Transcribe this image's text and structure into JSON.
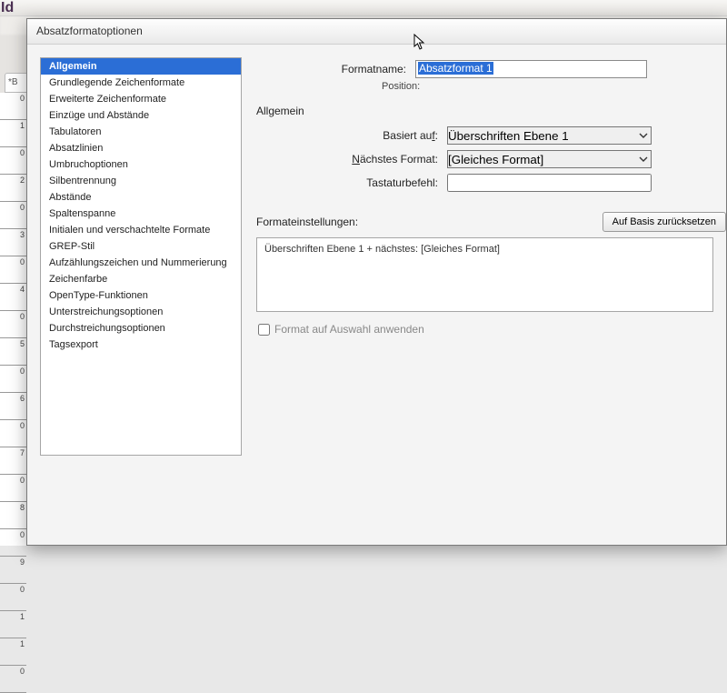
{
  "bg": {
    "logo": "Id",
    "tab": "*B",
    "ruler_ticks": [
      "0",
      "1",
      "0",
      "2",
      "0",
      "3",
      "0",
      "4",
      "0",
      "5",
      "0",
      "6",
      "0",
      "7",
      "0",
      "8",
      "0",
      "9",
      "0",
      "1",
      "1",
      "0"
    ]
  },
  "dialog": {
    "title": "Absatzformatoptionen"
  },
  "sidebar": {
    "items": [
      "Allgemein",
      "Grundlegende Zeichenformate",
      "Erweiterte Zeichenformate",
      "Einzüge und Abstände",
      "Tabulatoren",
      "Absatzlinien",
      "Umbruchoptionen",
      "Silbentrennung",
      "Abstände",
      "Spaltenspanne",
      "Initialen und verschachtelte Formate",
      "GREP-Stil",
      "Aufzählungszeichen und Nummerierung",
      "Zeichenfarbe",
      "OpenType-Funktionen",
      "Unterstreichungsoptionen",
      "Durchstreichungsoptionen",
      "Tagsexport"
    ],
    "selected_index": 0
  },
  "form": {
    "formatname_label": "Formatname:",
    "formatname_value": "Absatzformat 1",
    "position_label": "Position:",
    "section_heading": "Allgemein",
    "basiert_label_pre": "Basiert au",
    "basiert_label_u": "f",
    "basiert_label_post": ":",
    "basiert_value": "Überschriften Ebene 1",
    "naechstes_label_u": "N",
    "naechstes_label_rest": "ächstes Format:",
    "naechstes_value": "[Gleiches Format]",
    "tastatur_label": "Tastaturbefehl:",
    "tastatur_value": "",
    "settings_heading": "Formateinstellungen:",
    "reset_button": "Auf Basis zurücksetzen",
    "settings_text": "Überschriften Ebene 1 + nächstes: [Gleiches Format]",
    "apply_checkbox": "Format auf Auswahl anwenden"
  }
}
